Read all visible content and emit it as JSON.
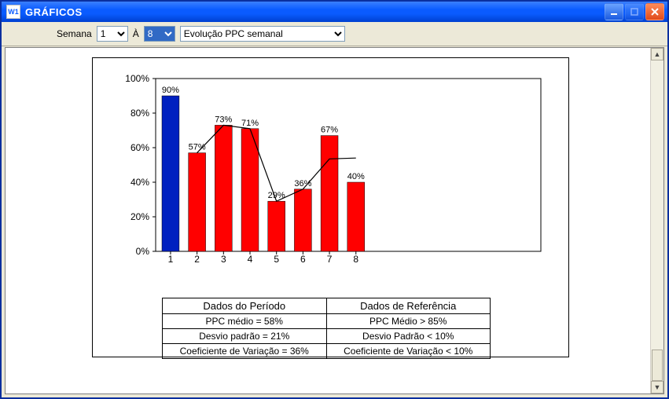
{
  "window": {
    "title": "GRÁFICOS",
    "app_icon_text": "W1"
  },
  "toolbar": {
    "semana_label": "Semana",
    "a_label": "À",
    "from_value": "1",
    "to_value": "8",
    "type_options": [
      "Evolução PPC semanal"
    ],
    "type_selected": "Evolução PPC semanal"
  },
  "chart_data": {
    "type": "bar",
    "categories": [
      "1",
      "2",
      "3",
      "4",
      "5",
      "6",
      "7",
      "8"
    ],
    "values": [
      90,
      57,
      73,
      71,
      29,
      36,
      67,
      40
    ],
    "value_labels": [
      "90%",
      "57%",
      "73%",
      "71%",
      "29%",
      "36%",
      "67%",
      "40%"
    ],
    "highlight_index": 0,
    "yticks": [
      0,
      20,
      40,
      60,
      80,
      100
    ],
    "ytick_labels": [
      "0%",
      "20%",
      "40%",
      "60%",
      "80%",
      "100%"
    ],
    "ylim": [
      0,
      100
    ],
    "line_series": {
      "start_index": 1,
      "values": [
        57,
        73,
        71,
        29,
        36,
        53.5,
        54
      ]
    },
    "colors": {
      "bar": "#ff0000",
      "highlight": "#0020c0",
      "line": "#000000"
    }
  },
  "stats": {
    "periodo_header": "Dados do Período",
    "ref_header": "Dados de Referência",
    "periodo": {
      "ppc": "PPC médio = 58%",
      "desvio": "Desvio padrão = 21%",
      "cv": "Coeficiente de Variação = 36%"
    },
    "referencia": {
      "ppc": "PPC Médio > 85%",
      "desvio": "Desvio Padrão < 10%",
      "cv": "Coeficiente de Variação < 10%"
    }
  }
}
